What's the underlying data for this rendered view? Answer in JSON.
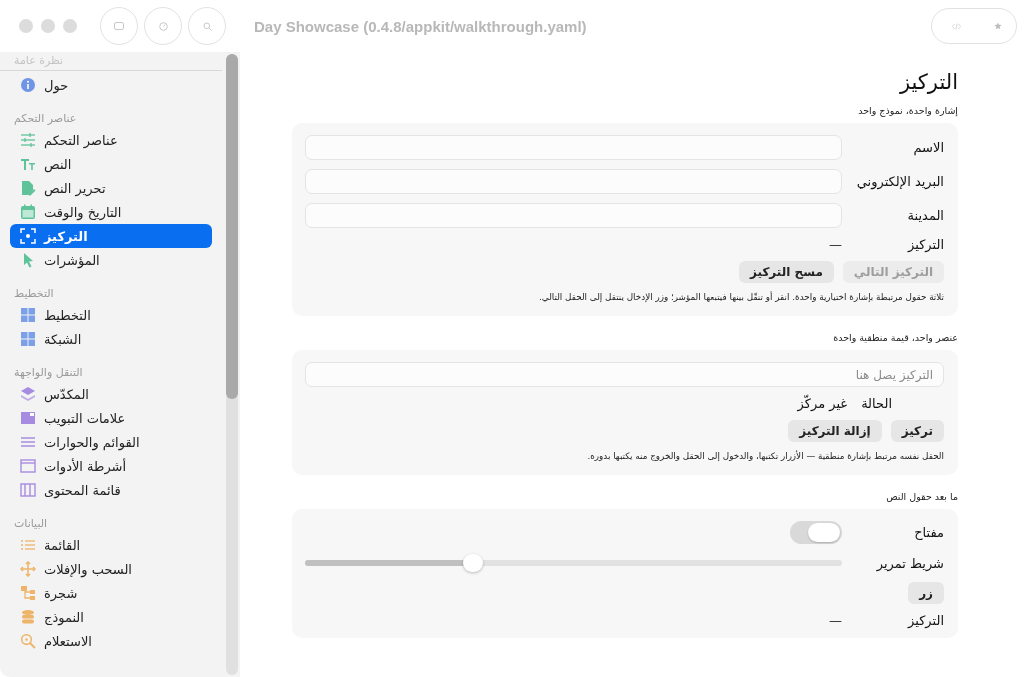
{
  "window": {
    "title": "Day Showcase (0.4.8/appkit/walkthrough.yaml)"
  },
  "sidebar": {
    "sections": [
      {
        "title": "نظرة عامة",
        "color": "#6f95e6",
        "items": [
          {
            "label": "حول",
            "selected": false
          }
        ]
      },
      {
        "title": "عناصر التحكم",
        "color": "#5fc39a",
        "items": [
          {
            "label": "عناصر التحكم",
            "selected": false
          },
          {
            "label": "النص",
            "selected": false
          },
          {
            "label": "تحرير النص",
            "selected": false
          },
          {
            "label": "التاريخ والوقت",
            "selected": false
          },
          {
            "label": "التركيز",
            "selected": true
          },
          {
            "label": "المؤشرات",
            "selected": false
          }
        ]
      },
      {
        "title": "التخطيط",
        "color": "#7ba0e8",
        "items": [
          {
            "label": "التخطيط",
            "selected": false
          },
          {
            "label": "الشبكة",
            "selected": false
          }
        ]
      },
      {
        "title": "التنقل والواجهة",
        "color": "#a78be0",
        "items": [
          {
            "label": "المكدّس",
            "selected": false
          },
          {
            "label": "علامات التبويب",
            "selected": false
          },
          {
            "label": "القوائم والحوارات",
            "selected": false
          },
          {
            "label": "أشرطة الأدوات",
            "selected": false
          },
          {
            "label": "قائمة المحتوى",
            "selected": false
          }
        ]
      },
      {
        "title": "البيانات",
        "color": "#eeb468",
        "items": [
          {
            "label": "القائمة",
            "selected": false
          },
          {
            "label": "السحب والإفلات",
            "selected": false
          },
          {
            "label": "شجرة",
            "selected": false
          },
          {
            "label": "النموذج",
            "selected": false
          },
          {
            "label": "الاستعلام",
            "selected": false
          }
        ]
      }
    ]
  },
  "page": {
    "title": "التركيز",
    "sections": [
      {
        "caption": "إشارة واحدة، نموذج واحد",
        "rows": [
          {
            "kind": "field",
            "label": "الاسم"
          },
          {
            "kind": "field",
            "label": "البريد الإلكتروني"
          },
          {
            "kind": "field",
            "label": "المدينة"
          },
          {
            "kind": "value",
            "label": "التركيز",
            "value": "—"
          },
          {
            "kind": "buttons",
            "buttons": [
              {
                "label": "التركيز التالي",
                "disabled": true
              },
              {
                "label": "مسح التركيز",
                "disabled": false
              }
            ]
          },
          {
            "kind": "note",
            "text": "ثلاثة حقول مرتبطة بإشارة اختيارية واحدة. انقر أو تنقّل بينها فيتبعها المؤشر؛ وزر الإدخال ينتقل إلى الحقل التالي."
          }
        ]
      },
      {
        "caption": "عنصر واحد، قيمة منطقية واحدة",
        "rows": [
          {
            "kind": "wide-field",
            "placeholder": "التركيز يصل هنا"
          },
          {
            "kind": "status",
            "label": "الحالة",
            "value": "غير مركّز"
          },
          {
            "kind": "buttons",
            "buttons": [
              {
                "label": "تركيز",
                "disabled": false
              },
              {
                "label": "إزالة التركيز",
                "disabled": false
              }
            ]
          },
          {
            "kind": "note",
            "text": "الحقل نفسه مرتبط بإشارة منطقية — الأزرار تكتبها، والدخول إلى الحقل والخروج منه يكتبها بدوره."
          }
        ]
      },
      {
        "caption": "ما بعد حقول النص",
        "rows": [
          {
            "kind": "toggle",
            "label": "مفتاح",
            "on": false
          },
          {
            "kind": "slider",
            "label": "شريط تمرير",
            "level": 0.31
          },
          {
            "kind": "buttons",
            "buttons": [
              {
                "label": "زر",
                "disabled": false
              }
            ]
          },
          {
            "kind": "value",
            "label": "التركيز",
            "value": "—"
          }
        ]
      }
    ]
  }
}
